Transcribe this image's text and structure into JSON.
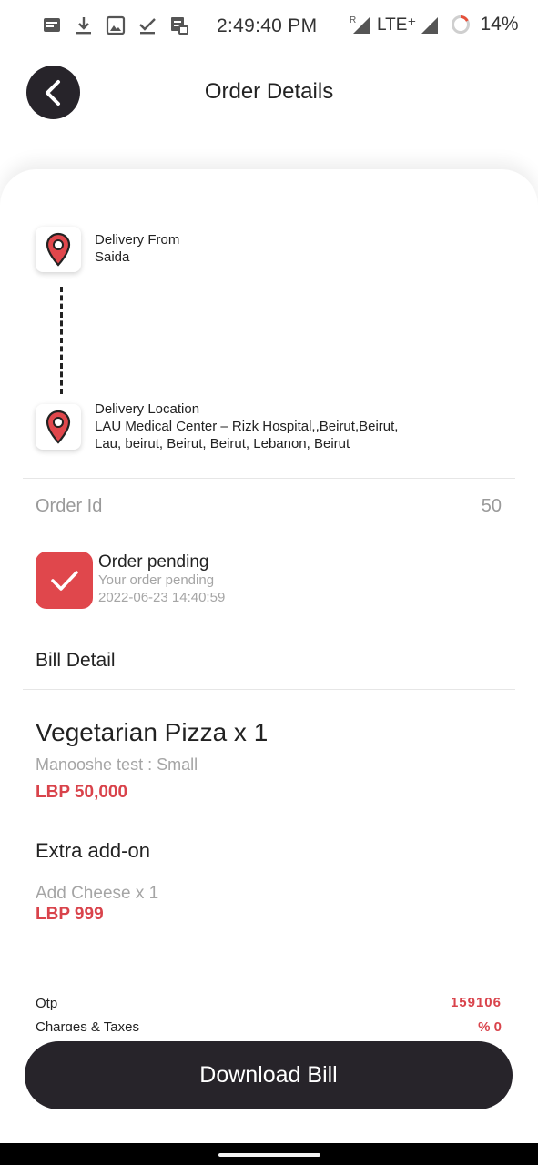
{
  "status_bar": {
    "time": "2:49:40 PM",
    "roaming": "R",
    "network": "LTE⁺",
    "battery": "14%",
    "icons": [
      "message-icon",
      "download-icon",
      "image-icon",
      "checkmark-icon",
      "sim-card-icon"
    ]
  },
  "header": {
    "title": "Order Details",
    "back_icon": "chevron-left-icon"
  },
  "route": {
    "from_label": "Delivery From",
    "from_value": "Saida",
    "to_label": "Delivery Location",
    "to_line1": "LAU Medical Center – Rizk Hospital,,Beirut,Beirut,",
    "to_line2": "Lau, beirut, Beirut, Beirut, Lebanon, Beirut",
    "pin_icon": "map-pin-icon",
    "pin_color": "#e0474c"
  },
  "order": {
    "id_label": "Order Id",
    "id_value": "50",
    "status_title": "Order pending",
    "status_sub": "Your order pending",
    "status_time": "2022-06-23 14:40:59",
    "status_color": "#e0474c"
  },
  "bill": {
    "title": "Bill Detail",
    "item_name": "Vegetarian Pizza x 1",
    "item_variant": "Manooshe test : Small",
    "item_price": "LBP 50,000",
    "addon_title": "Extra add-on",
    "addon_name": "Add Cheese x 1",
    "addon_price": "LBP 999",
    "otp_label": "Otp",
    "otp_value": "159106",
    "tax_label": "Charges & Taxes",
    "tax_value": "% 0",
    "accent_color": "#d9434b"
  },
  "actions": {
    "download_label": "Download Bill"
  }
}
